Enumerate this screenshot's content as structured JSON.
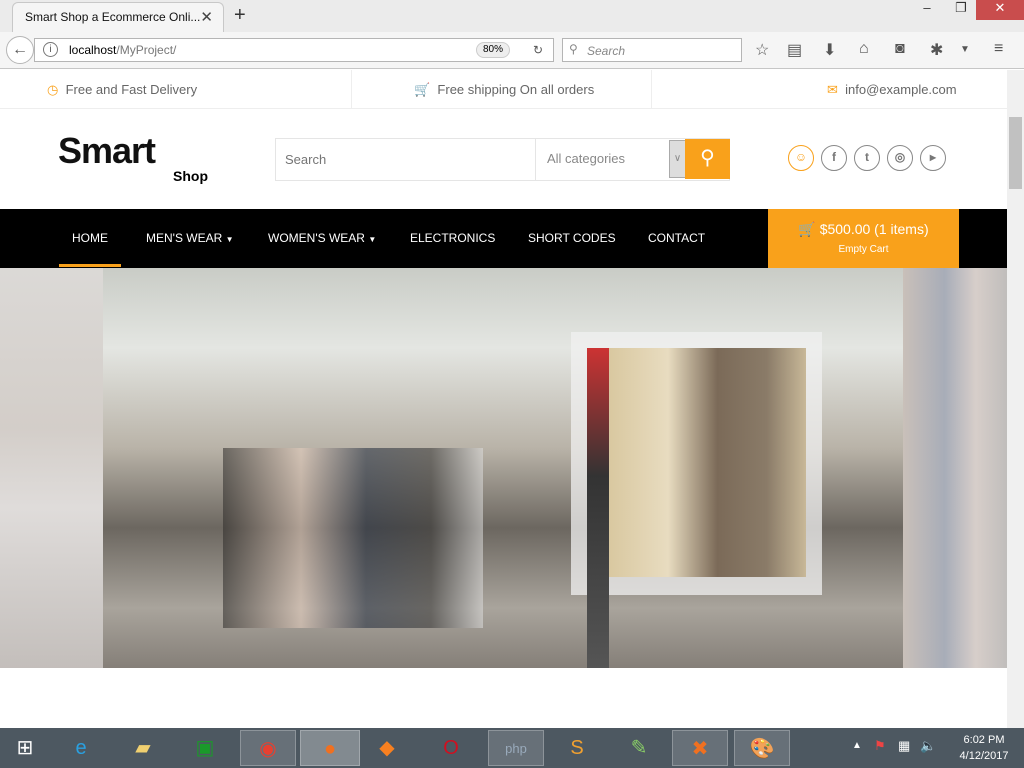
{
  "browser": {
    "tab_title": "Smart Shop a Ecommerce Onli...",
    "url_host": "localhost",
    "url_path": "/MyProject/",
    "zoom": "80%",
    "search_placeholder": "Search"
  },
  "topbar": {
    "delivery": "Free and Fast Delivery",
    "shipping": "Free shipping On all orders",
    "email": "info@example.com"
  },
  "logo": {
    "main": "Smart",
    "sub": "Shop"
  },
  "search": {
    "placeholder": "Search",
    "category": "All categories"
  },
  "nav": {
    "items": [
      "HOME",
      "MEN'S WEAR",
      "WOMEN'S WEAR",
      "ELECTRONICS",
      "SHORT CODES",
      "CONTACT"
    ]
  },
  "cart": {
    "total": "$500.00 (1 items)",
    "action": "Empty Cart"
  },
  "clock": {
    "time": "6:02 PM",
    "date": "4/12/2017"
  },
  "colors": {
    "accent": "#f9a11b",
    "nav_bg": "#000000"
  }
}
